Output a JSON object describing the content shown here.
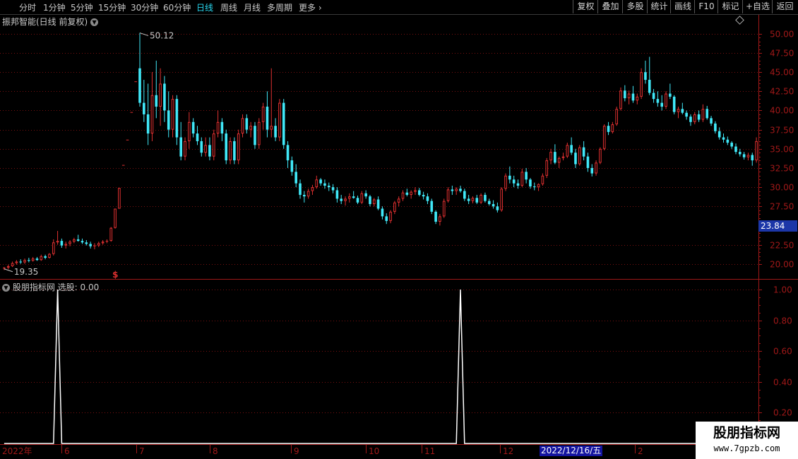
{
  "toolbar": {
    "timeframes": [
      "分时",
      "1分钟",
      "5分钟",
      "15分钟",
      "30分钟",
      "60分钟",
      "日线",
      "周线",
      "月线",
      "多周期",
      "更多"
    ],
    "active": "日线",
    "right_buttons": [
      "复权",
      "叠加",
      "多股",
      "统计",
      "画线",
      "F10",
      "标记",
      "+自选",
      "返回"
    ]
  },
  "stock": {
    "title": "振邦智能(日线 前复权)"
  },
  "indicator": {
    "name": "股朋指标网",
    "label": "选股: 0.00"
  },
  "price_axis": {
    "labels": [
      "50.00",
      "47.50",
      "45.00",
      "42.50",
      "40.00",
      "37.50",
      "35.00",
      "32.50",
      "30.00",
      "27.50",
      "22.50",
      "20.00"
    ]
  },
  "indicator_axis": {
    "labels": [
      "1.00",
      "0.80",
      "0.60",
      "0.40",
      "0.20"
    ]
  },
  "current_price": "23.84",
  "annotations": {
    "high": "50.12",
    "low": "19.35",
    "signal": "$"
  },
  "date_axis": {
    "labels": [
      "2022年",
      "6",
      "7",
      "8",
      "9",
      "10",
      "11",
      "12",
      "2"
    ],
    "cursor": "2022/12/16/五"
  },
  "watermark": {
    "title": "股朋指标网",
    "url": "www.7gpzb.com"
  },
  "colors": {
    "up": "#e03030",
    "down": "#40e8f8",
    "axis": "#a01818",
    "active_tab": "#28d8f0"
  },
  "chart_data": {
    "type": "candlestick",
    "price_range": [
      18.5,
      51
    ],
    "candles": [
      [
        19.4,
        19.6,
        19.2,
        19.5
      ],
      [
        19.5,
        19.9,
        19.3,
        19.7
      ],
      [
        19.7,
        20.3,
        19.6,
        20.1
      ],
      [
        20.1,
        20.5,
        19.9,
        20.3
      ],
      [
        20.3,
        20.6,
        20.0,
        20.2
      ],
      [
        20.2,
        20.7,
        20.0,
        20.5
      ],
      [
        20.5,
        20.8,
        20.2,
        20.4
      ],
      [
        20.4,
        20.9,
        20.3,
        20.7
      ],
      [
        20.7,
        20.9,
        20.4,
        20.5
      ],
      [
        20.5,
        21.2,
        20.4,
        21.0
      ],
      [
        21.0,
        21.2,
        20.6,
        20.8
      ],
      [
        20.8,
        21.4,
        20.7,
        21.3
      ],
      [
        21.3,
        23.2,
        21.1,
        22.8
      ],
      [
        22.8,
        24.3,
        22.5,
        23.0
      ],
      [
        23.0,
        23.3,
        22.1,
        22.4
      ],
      [
        22.4,
        22.9,
        22.0,
        22.6
      ],
      [
        22.6,
        23.1,
        22.3,
        22.9
      ],
      [
        22.9,
        23.4,
        22.7,
        23.2
      ],
      [
        23.2,
        23.8,
        22.9,
        23.0
      ],
      [
        23.0,
        23.3,
        22.6,
        22.8
      ],
      [
        22.8,
        23.1,
        22.4,
        22.6
      ],
      [
        22.6,
        22.9,
        22.0,
        22.3
      ],
      [
        22.3,
        22.7,
        21.9,
        22.4
      ],
      [
        22.4,
        22.9,
        22.2,
        22.7
      ],
      [
        22.7,
        23.1,
        22.5,
        22.9
      ],
      [
        22.9,
        23.2,
        22.7,
        23.0
      ],
      [
        23.0,
        24.8,
        22.9,
        24.7
      ],
      [
        24.7,
        27.2,
        24.6,
        27.2
      ],
      [
        27.2,
        29.9,
        27.2,
        29.9
      ],
      [
        32.9,
        32.9,
        32.9,
        32.9
      ],
      [
        36.2,
        36.2,
        36.2,
        36.2
      ],
      [
        39.8,
        39.8,
        39.8,
        39.8
      ],
      [
        43.8,
        43.8,
        43.8,
        43.8
      ],
      [
        45.5,
        50.12,
        40.5,
        41.0
      ],
      [
        41.0,
        44.0,
        38.5,
        39.5
      ],
      [
        39.5,
        43.5,
        35.5,
        37.0
      ],
      [
        37.0,
        45.0,
        36.0,
        42.0
      ],
      [
        42.0,
        46.5,
        39.0,
        40.5
      ],
      [
        40.5,
        45.5,
        38.0,
        43.5
      ],
      [
        43.5,
        44.5,
        38.5,
        40.0
      ],
      [
        40.0,
        42.5,
        36.5,
        37.5
      ],
      [
        37.5,
        42.0,
        36.5,
        41.5
      ],
      [
        41.5,
        42.0,
        35.5,
        36.5
      ],
      [
        36.5,
        38.5,
        33.5,
        34.0
      ],
      [
        34.0,
        36.5,
        33.5,
        36.0
      ],
      [
        36.0,
        39.8,
        35.0,
        38.5
      ],
      [
        38.5,
        39.0,
        36.5,
        37.0
      ],
      [
        37.0,
        38.0,
        35.5,
        36.0
      ],
      [
        36.0,
        36.5,
        34.0,
        34.5
      ],
      [
        34.5,
        36.5,
        34.0,
        35.5
      ],
      [
        35.5,
        36.5,
        33.5,
        34.0
      ],
      [
        34.0,
        37.5,
        33.5,
        37.0
      ],
      [
        37.0,
        40.0,
        36.5,
        38.5
      ],
      [
        38.5,
        39.0,
        36.0,
        37.0
      ],
      [
        37.0,
        37.5,
        33.0,
        33.5
      ],
      [
        33.5,
        36.5,
        33.0,
        36.0
      ],
      [
        36.0,
        36.5,
        33.0,
        33.5
      ],
      [
        33.5,
        37.5,
        33.0,
        37.0
      ],
      [
        37.0,
        39.5,
        36.5,
        39.0
      ],
      [
        39.0,
        39.5,
        37.0,
        37.5
      ],
      [
        37.5,
        38.5,
        36.5,
        38.0
      ],
      [
        38.0,
        38.5,
        35.0,
        35.5
      ],
      [
        35.5,
        39.0,
        35.0,
        38.5
      ],
      [
        38.5,
        41.0,
        37.5,
        40.5
      ],
      [
        40.5,
        42.5,
        36.5,
        37.5
      ],
      [
        37.5,
        45.5,
        36.5,
        38.0
      ],
      [
        38.0,
        39.0,
        36.0,
        36.5
      ],
      [
        36.5,
        41.5,
        36.0,
        41.0
      ],
      [
        41.0,
        41.5,
        35.0,
        35.5
      ],
      [
        35.5,
        36.0,
        32.5,
        33.5
      ],
      [
        33.5,
        34.0,
        31.5,
        32.0
      ],
      [
        32.0,
        33.0,
        30.0,
        30.5
      ],
      [
        30.5,
        31.0,
        28.5,
        29.0
      ],
      [
        29.0,
        29.5,
        28.0,
        28.8
      ],
      [
        28.8,
        29.8,
        28.5,
        29.5
      ],
      [
        29.5,
        30.3,
        29.0,
        30.0
      ],
      [
        30.0,
        31.5,
        29.8,
        31.0
      ],
      [
        31.0,
        31.2,
        30.2,
        30.5
      ],
      [
        30.5,
        31.0,
        29.8,
        30.2
      ],
      [
        30.2,
        30.6,
        29.5,
        30.0
      ],
      [
        30.0,
        30.4,
        29.2,
        29.6
      ],
      [
        29.6,
        30.0,
        28.0,
        28.5
      ],
      [
        28.5,
        29.0,
        27.8,
        28.2
      ],
      [
        28.2,
        28.8,
        27.6,
        28.5
      ],
      [
        28.5,
        29.2,
        28.0,
        28.8
      ],
      [
        28.8,
        29.5,
        28.5,
        28.6
      ],
      [
        28.6,
        28.9,
        27.8,
        28.0
      ],
      [
        28.0,
        29.5,
        27.8,
        29.2
      ],
      [
        29.2,
        29.6,
        28.5,
        28.8
      ],
      [
        28.8,
        29.0,
        27.5,
        27.8
      ],
      [
        27.8,
        28.6,
        27.5,
        28.4
      ],
      [
        28.4,
        28.8,
        27.0,
        27.2
      ],
      [
        27.2,
        27.5,
        25.8,
        26.2
      ],
      [
        26.2,
        26.6,
        25.2,
        25.6
      ],
      [
        25.6,
        27.0,
        25.3,
        26.8
      ],
      [
        26.8,
        28.2,
        26.5,
        28.0
      ],
      [
        28.0,
        28.8,
        27.5,
        28.5
      ],
      [
        28.5,
        29.6,
        28.2,
        29.3
      ],
      [
        29.3,
        29.8,
        28.8,
        29.0
      ],
      [
        29.0,
        29.6,
        28.5,
        29.4
      ],
      [
        29.4,
        30.0,
        29.0,
        29.6
      ],
      [
        29.6,
        29.9,
        28.8,
        29.0
      ],
      [
        29.0,
        29.4,
        28.4,
        28.8
      ],
      [
        28.8,
        29.2,
        27.8,
        28.2
      ],
      [
        28.2,
        28.5,
        26.5,
        26.8
      ],
      [
        26.8,
        27.0,
        25.2,
        25.5
      ],
      [
        25.5,
        26.5,
        25.0,
        26.2
      ],
      [
        26.2,
        28.5,
        26.0,
        28.2
      ],
      [
        28.2,
        30.0,
        28.0,
        29.7
      ],
      [
        29.7,
        30.2,
        29.0,
        29.5
      ],
      [
        29.5,
        30.0,
        29.0,
        29.8
      ],
      [
        29.8,
        30.2,
        29.3,
        29.5
      ],
      [
        29.5,
        29.8,
        28.2,
        28.5
      ],
      [
        28.5,
        29.0,
        27.8,
        28.2
      ],
      [
        28.2,
        28.8,
        27.9,
        28.6
      ],
      [
        28.6,
        29.0,
        27.8,
        28.0
      ],
      [
        28.0,
        29.2,
        27.8,
        29.0
      ],
      [
        29.0,
        29.3,
        28.0,
        28.2
      ],
      [
        28.2,
        28.5,
        27.6,
        27.8
      ],
      [
        27.8,
        28.3,
        27.2,
        27.5
      ],
      [
        27.5,
        28.0,
        26.7,
        27.0
      ],
      [
        27.0,
        30.0,
        26.8,
        29.8
      ],
      [
        29.8,
        31.8,
        29.5,
        31.5
      ],
      [
        31.5,
        32.7,
        30.5,
        31.0
      ],
      [
        31.0,
        31.5,
        30.0,
        30.5
      ],
      [
        30.5,
        31.0,
        29.8,
        30.2
      ],
      [
        30.2,
        32.4,
        30.0,
        32.0
      ],
      [
        32.0,
        32.5,
        30.5,
        31.0
      ],
      [
        31.0,
        31.2,
        29.8,
        30.1
      ],
      [
        30.1,
        30.6,
        29.6,
        30.0
      ],
      [
        30.0,
        30.5,
        29.5,
        30.4
      ],
      [
        30.4,
        31.8,
        30.2,
        31.5
      ],
      [
        31.5,
        33.8,
        31.2,
        33.5
      ],
      [
        33.5,
        35.0,
        33.0,
        34.6
      ],
      [
        34.6,
        35.6,
        33.0,
        33.2
      ],
      [
        33.2,
        34.0,
        32.5,
        33.8
      ],
      [
        33.8,
        34.5,
        33.5,
        34.0
      ],
      [
        34.0,
        35.8,
        33.8,
        35.5
      ],
      [
        35.5,
        36.5,
        34.2,
        34.5
      ],
      [
        34.5,
        35.0,
        32.5,
        33.0
      ],
      [
        33.0,
        35.5,
        32.8,
        35.2
      ],
      [
        35.2,
        36.0,
        33.5,
        34.0
      ],
      [
        34.0,
        34.5,
        32.0,
        32.5
      ],
      [
        32.5,
        33.0,
        31.4,
        31.8
      ],
      [
        31.8,
        33.5,
        31.5,
        33.2
      ],
      [
        33.2,
        35.2,
        33.0,
        35.0
      ],
      [
        35.0,
        38.2,
        34.8,
        38.0
      ],
      [
        38.0,
        38.5,
        36.8,
        37.2
      ],
      [
        37.2,
        38.5,
        37.0,
        38.2
      ],
      [
        38.2,
        40.5,
        38.0,
        40.2
      ],
      [
        40.2,
        43.0,
        40.0,
        42.6
      ],
      [
        42.6,
        43.3,
        41.2,
        41.6
      ],
      [
        41.6,
        42.6,
        40.8,
        42.2
      ],
      [
        42.2,
        43.2,
        41.0,
        41.3
      ],
      [
        41.3,
        42.2,
        40.8,
        41.8
      ],
      [
        41.8,
        45.5,
        41.5,
        45.0
      ],
      [
        45.0,
        46.5,
        43.5,
        44.0
      ],
      [
        44.0,
        47.0,
        42.0,
        42.3
      ],
      [
        42.3,
        42.8,
        41.0,
        41.5
      ],
      [
        41.5,
        42.5,
        40.5,
        41.0
      ],
      [
        41.0,
        42.0,
        40.0,
        40.5
      ],
      [
        40.5,
        42.5,
        40.2,
        42.2
      ],
      [
        42.2,
        43.5,
        41.5,
        41.8
      ],
      [
        41.8,
        42.0,
        39.5,
        39.8
      ],
      [
        39.8,
        40.5,
        39.0,
        40.2
      ],
      [
        40.2,
        41.0,
        39.5,
        39.7
      ],
      [
        39.7,
        40.0,
        38.8,
        39.2
      ],
      [
        39.2,
        39.5,
        38.0,
        38.5
      ],
      [
        38.5,
        39.8,
        38.2,
        39.5
      ],
      [
        39.5,
        40.0,
        38.5,
        38.8
      ],
      [
        38.8,
        40.8,
        38.5,
        40.2
      ],
      [
        40.2,
        40.6,
        38.8,
        39.0
      ],
      [
        39.0,
        39.3,
        38.0,
        38.3
      ],
      [
        38.3,
        38.6,
        37.0,
        37.3
      ],
      [
        37.3,
        37.8,
        36.2,
        36.5
      ],
      [
        36.5,
        37.0,
        35.8,
        36.2
      ],
      [
        36.2,
        36.6,
        35.5,
        35.8
      ],
      [
        35.8,
        36.0,
        35.0,
        35.3
      ],
      [
        35.3,
        35.7,
        34.3,
        34.6
      ],
      [
        34.6,
        35.0,
        34.0,
        34.3
      ],
      [
        34.3,
        34.6,
        33.6,
        33.9
      ],
      [
        33.9,
        34.5,
        33.5,
        34.2
      ],
      [
        34.2,
        34.5,
        32.8,
        33.5
      ],
      [
        33.5,
        36.5,
        33.2,
        36.0
      ]
    ],
    "signal": {
      "range": [
        0,
        1
      ],
      "spikes": [
        {
          "index": 13,
          "value": 1.0
        },
        {
          "index": 111,
          "value": 1.0
        }
      ]
    }
  }
}
